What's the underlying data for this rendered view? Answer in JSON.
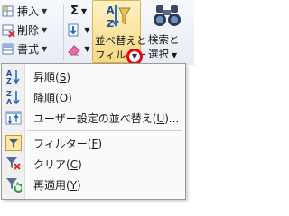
{
  "ribbon": {
    "cells": [
      {
        "label": "挿入",
        "icon": "insert-cells-icon"
      },
      {
        "label": "削除",
        "icon": "delete-cells-icon"
      },
      {
        "label": "書式",
        "icon": "format-cells-icon"
      }
    ],
    "editing": {
      "autosum_symbol": "Σ",
      "fill_icon": "fill-down-icon",
      "clear_icon": "eraser-icon"
    },
    "sort_filter": {
      "line1": "並べ替えと",
      "line2": "フィルター"
    },
    "find_select": {
      "line1": "検索と",
      "line2": "選択"
    },
    "highlight_color": "#e3061a"
  },
  "menu": {
    "items": [
      {
        "key": "sort_asc",
        "label": "昇順(",
        "accel": "S",
        "tail": ")",
        "icon": "sort-ascending-icon"
      },
      {
        "key": "sort_desc",
        "label": "降順(",
        "accel": "O",
        "tail": ")",
        "icon": "sort-descending-icon"
      },
      {
        "key": "custom_sort",
        "label": "ユーザー設定の並べ替え(",
        "accel": "U",
        "tail": ")...",
        "icon": "custom-sort-icon"
      },
      {
        "key": "filter",
        "label": "フィルター(",
        "accel": "F",
        "tail": ")",
        "icon": "filter-icon"
      },
      {
        "key": "clear",
        "label": "クリア(",
        "accel": "C",
        "tail": ")",
        "icon": "clear-filter-icon"
      },
      {
        "key": "reapply",
        "label": "再適用(",
        "accel": "Y",
        "tail": ")",
        "icon": "reapply-filter-icon"
      }
    ]
  }
}
